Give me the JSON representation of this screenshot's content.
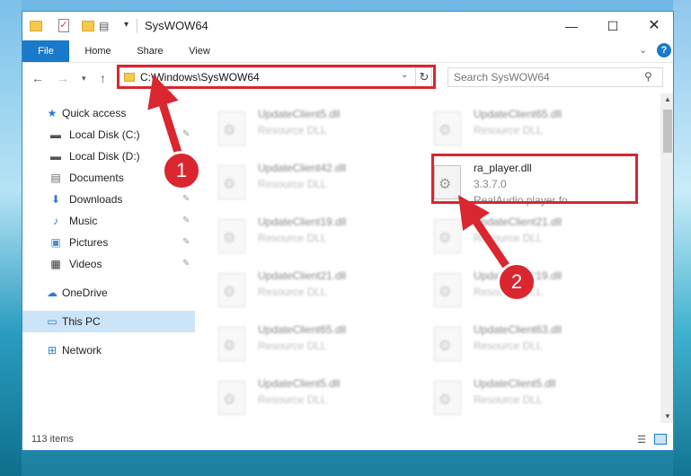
{
  "window": {
    "title": "SysWOW64",
    "controls": {
      "minimize": "—",
      "maximize": "☐",
      "close": "✕"
    }
  },
  "ribbon": {
    "tabs": [
      {
        "label": "File",
        "active": true
      },
      {
        "label": "Home"
      },
      {
        "label": "Share"
      },
      {
        "label": "View"
      }
    ],
    "help": "?"
  },
  "nav": {
    "address": "C:\\Windows\\SysWOW64",
    "search_placeholder": "Search SysWOW64"
  },
  "sidebar": {
    "items": [
      {
        "label": "Quick access",
        "icon": "star-icon",
        "glyph": "★",
        "color": "#2b7cd3"
      },
      {
        "label": "Local Disk (C:)",
        "icon": "drive-icon",
        "glyph": "▬",
        "color": "#555555",
        "pinned": true
      },
      {
        "label": "Local Disk (D:)",
        "icon": "drive-icon",
        "glyph": "▬",
        "color": "#555555"
      },
      {
        "label": "Documents",
        "icon": "documents-icon",
        "glyph": "▤",
        "color": "#6b6b6b"
      },
      {
        "label": "Downloads",
        "icon": "download-icon",
        "glyph": "⬇",
        "color": "#2b7cd3",
        "pinned": true
      },
      {
        "label": "Music",
        "icon": "music-icon",
        "glyph": "♪",
        "color": "#2b7cd3",
        "pinned": true
      },
      {
        "label": "Pictures",
        "icon": "pictures-icon",
        "glyph": "▣",
        "color": "#4a8fd0",
        "pinned": true
      },
      {
        "label": "Videos",
        "icon": "videos-icon",
        "glyph": "▦",
        "color": "#333333",
        "pinned": true
      },
      {
        "label": "OneDrive",
        "icon": "cloud-icon",
        "glyph": "☁",
        "color": "#2b7cd3"
      },
      {
        "label": "This PC",
        "icon": "computer-icon",
        "glyph": "▭",
        "color": "#2b7cd3",
        "selected": true
      },
      {
        "label": "Network",
        "icon": "network-icon",
        "glyph": "⊞",
        "color": "#2b7cd3"
      }
    ]
  },
  "files": {
    "left": [
      {
        "name": "UpdateClient5.dll",
        "type": "Resource DLL"
      },
      {
        "name": "UpdateClient42.dll",
        "type": "Resource DLL"
      },
      {
        "name": "UpdateClient19.dll",
        "type": "Resource DLL"
      },
      {
        "name": "UpdateClient21.dll",
        "type": "Resource DLL"
      },
      {
        "name": "UpdateClient65.dll",
        "type": "Resource DLL"
      },
      {
        "name": "UpdateClient5.dll",
        "type": "Resource DLL"
      }
    ],
    "right": [
      {
        "name": "UpdateClient65.dll",
        "type": "Resource DLL"
      },
      {
        "name": "ra_player.dll",
        "version": "3.3.7.0",
        "description": "RealAudio player fo...",
        "highlight": true
      },
      {
        "name": "UpdateClient21.dll",
        "type": "Resource DLL"
      },
      {
        "name": "UpdateClient19.dll",
        "type": "Resource DLL"
      },
      {
        "name": "UpdateClient63.dll",
        "type": "Resource DLL"
      },
      {
        "name": "UpdateClient5.dll",
        "type": "Resource DLL"
      }
    ]
  },
  "status": {
    "count": "113 items"
  },
  "callouts": [
    {
      "number": "1"
    },
    {
      "number": "2"
    }
  ],
  "colors": {
    "accent": "#1979ca",
    "annotation": "#d9262f",
    "selection": "#cce4f7"
  }
}
